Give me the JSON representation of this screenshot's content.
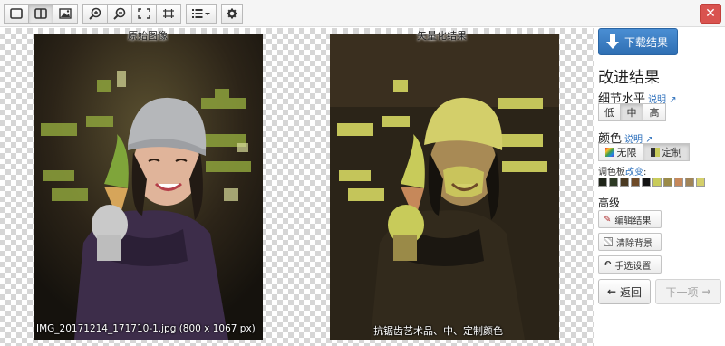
{
  "toolbar": {
    "icons": [
      "single-pane-icon",
      "split-view-icon",
      "image-icon",
      "zoom-in-icon",
      "zoom-out-icon",
      "fit-screen-icon",
      "actual-size-icon",
      "menu-list-icon",
      "gear-icon"
    ],
    "close_icon": "close-icon"
  },
  "canvas": {
    "original_caption": "原始图像",
    "vector_caption": "矢量化结果",
    "original_filename": "IMG_20171214_171710-1.jpg (800 x 1067 px)",
    "vector_settings": "抗锯齿艺术品、中、定制颜色"
  },
  "panel": {
    "download_label": "下载结果",
    "heading": "改进结果",
    "detail_label": "细节水平",
    "help_label": "说明",
    "detail_options": [
      "低",
      "中",
      "高"
    ],
    "detail_selected": "中",
    "color_label": "颜色",
    "color_options": [
      "无限",
      "定制"
    ],
    "color_selected": "定制",
    "palette_label": "调色板",
    "palette_change": "改变",
    "palette_colors": [
      "#1e2418",
      "#2d3a24",
      "#4a3a22",
      "#6e4a28",
      "#131313",
      "#c8cb5a",
      "#9a8a48",
      "#c6885a",
      "#a08458",
      "#d4cf6a"
    ],
    "advanced_label": "高级",
    "edit_label": "编辑结果",
    "clear_bg_label": "清除背景",
    "pick_label": "手选设置",
    "back_label": "返回",
    "next_label": "下一项"
  },
  "colors": {
    "accent": "#2f6fb3",
    "close": "#d9534f"
  }
}
